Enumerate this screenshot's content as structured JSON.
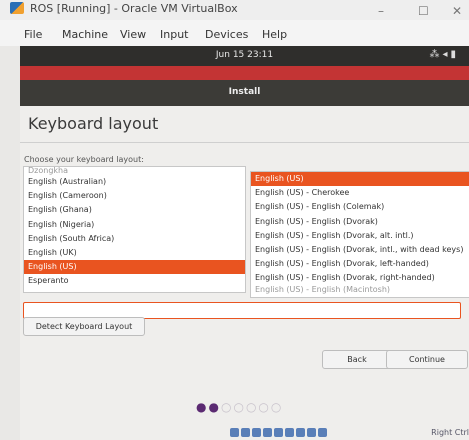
{
  "window": {
    "title": "ROS [Running] - Oracle VM VirtualBox",
    "minimize": "–",
    "maximize": "☐",
    "close": "✕"
  },
  "menubar": [
    "File",
    "Machine",
    "View",
    "Input",
    "Devices",
    "Help"
  ],
  "topbar": {
    "clock": "Jun 15 23:11",
    "tray_icons": [
      "network-icon",
      "volume-icon",
      "battery-icon"
    ]
  },
  "installer": {
    "header": "Install",
    "title": "Keyboard layout",
    "prompt": "Choose your keyboard layout:",
    "layouts": {
      "partial_top": "Dzongkha",
      "items": [
        "English (Australian)",
        "English (Cameroon)",
        "English (Ghana)",
        "English (Nigeria)",
        "English (South Africa)",
        "English (UK)",
        "English (US)",
        "Esperanto"
      ],
      "selected": 6
    },
    "variants": {
      "items": [
        "English (US)",
        "English (US) - Cherokee",
        "English (US) - English (Colemak)",
        "English (US) - English (Dvorak)",
        "English (US) - English (Dvorak, alt. intl.)",
        "English (US) - English (Dvorak, intl., with dead keys)",
        "English (US) - English (Dvorak, left-handed)",
        "English (US) - English (Dvorak, right-handed)"
      ],
      "partial_bottom": "English (US) - English (Macintosh)",
      "selected": 0
    },
    "test_input_value": "",
    "detect_button": "Detect Keyboard Layout",
    "back_button": "Back",
    "continue_button": "Continue",
    "progress": {
      "current_step": 2,
      "total_steps": 7
    }
  },
  "host": {
    "hostkey": "Right Ctrl"
  },
  "colors": {
    "accent": "#e95420",
    "header_red": "#c33434",
    "topbar": "#2f2e2c",
    "dot_active": "#5b2a72"
  }
}
